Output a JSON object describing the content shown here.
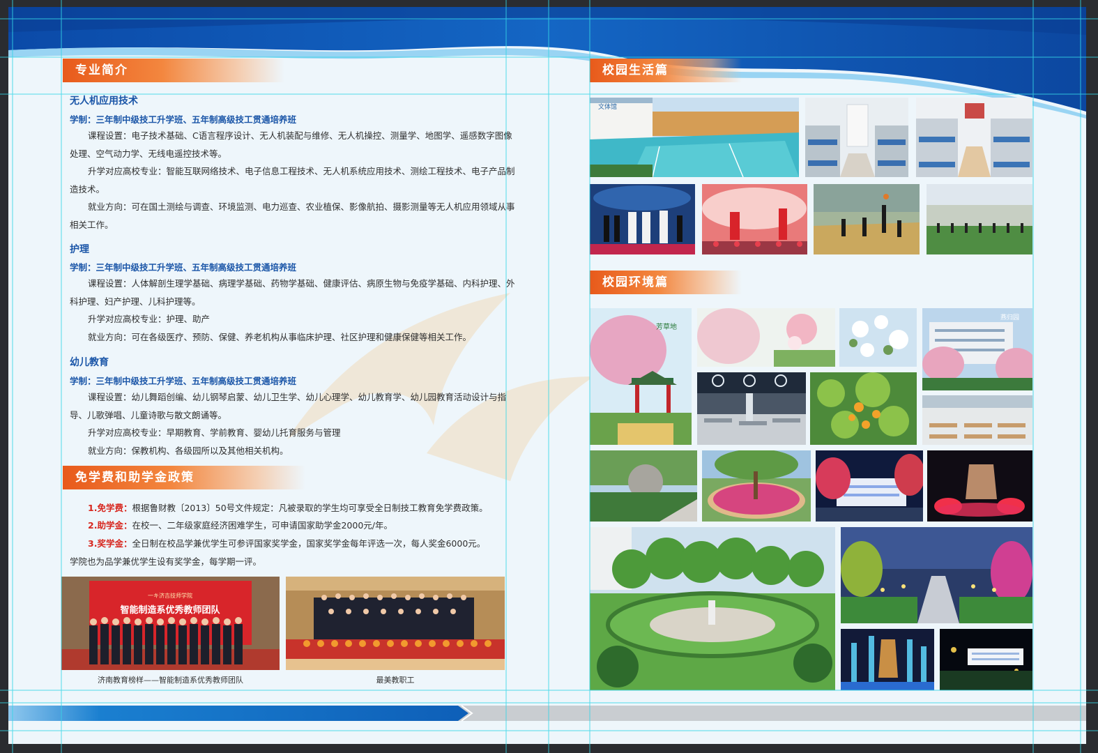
{
  "left": {
    "section1": {
      "title": "专业简介",
      "programs": [
        {
          "name": "无人机应用技术",
          "system": "学制：三年制中级技工升学班、五年制高级技工贯通培养班",
          "paragraphs": [
            "课程设置：电子技术基础、C语言程序设计、无人机装配与维修、无人机操控、测量学、地图学、遥感数字图像处理、空气动力学、无线电遥控技术等。",
            "升学对应高校专业：智能互联网络技术、电子信息工程技术、无人机系统应用技术、测绘工程技术、电子产品制造技术。",
            "就业方向：可在国土测绘与调查、环境监测、电力巡查、农业植保、影像航拍、摄影测量等无人机应用领域从事相关工作。"
          ]
        },
        {
          "name": "护理",
          "system": "学制：三年制中级技工升学班、五年制高级技工贯通培养班",
          "paragraphs": [
            "课程设置：人体解剖生理学基础、病理学基础、药物学基础、健康评估、病原生物与免疫学基础、内科护理、外科护理、妇产护理、儿科护理等。",
            "升学对应高校专业：护理、助产",
            "就业方向：可在各级医疗、预防、保健、养老机构从事临床护理、社区护理和健康保健等相关工作。"
          ]
        },
        {
          "name": "幼儿教育",
          "system": "学制：三年制中级技工升学班、五年制高级技工贯通培养班",
          "paragraphs": [
            "课程设置：幼儿舞蹈创编、幼儿钢琴启蒙、幼儿卫生学、幼儿心理学、幼儿教育学、幼儿园教育活动设计与指导、儿歌弹唱、儿童诗歌与散文朗诵等。",
            "升学对应高校专业：早期教育、学前教育、婴幼儿托育服务与管理",
            "就业方向：保教机构、各级园所以及其他相关机构。"
          ]
        }
      ]
    },
    "section2": {
      "title": "免学费和助学金政策",
      "items": [
        {
          "label": "1.免学费：",
          "text": "根据鲁财教〔2013〕50号文件规定：凡被录取的学生均可享受全日制技工教育免学费政策。"
        },
        {
          "label": "2.助学金：",
          "text": "在校一、二年级家庭经济困难学生，可申请国家助学金2000元/年。"
        },
        {
          "label": "3.奖学金：",
          "text": "全日制在校品学兼优学生可参评国家奖学金，国家奖学金每年评选一次，每人奖金6000元。"
        }
      ],
      "extra": "学院也为品学兼优学生设有奖学金，每学期一评。"
    },
    "photos": {
      "photo1_sign_school": "一キ济吉技师学院",
      "photo1_sign_main": "智能制造系优秀教师团队",
      "caption1": "济南教育榜样——智能制造系优秀教师团队",
      "caption2": "最美教职工"
    }
  },
  "right": {
    "life_title": "校园生活篇",
    "env_title": "校园环境篇",
    "sign_culture": "文体馆",
    "sign_fangcao": "芳草地",
    "sign_yanguo": "燕归园"
  },
  "colors": {
    "accent_blue": "#1b56a8",
    "accent_orange": "#e85a1b",
    "accent_red": "#d7261e"
  }
}
